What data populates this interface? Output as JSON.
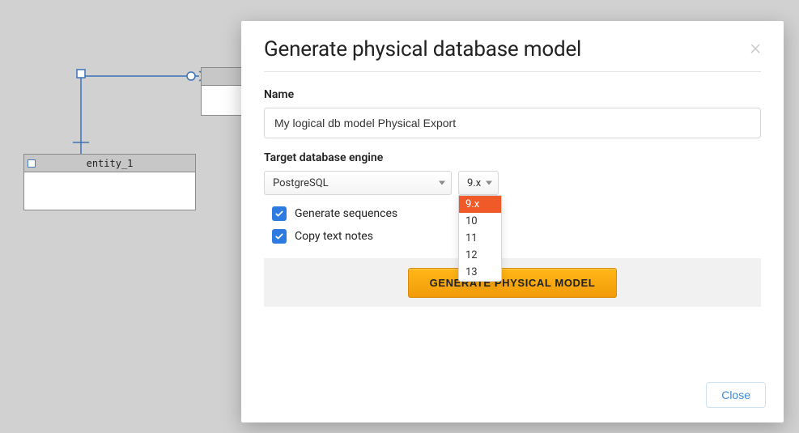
{
  "canvas": {
    "entity1_label": "entity_1"
  },
  "modal": {
    "title": "Generate physical database model",
    "name_label": "Name",
    "name_value": "My logical db model Physical Export",
    "target_label": "Target database engine",
    "engine_value": "PostgreSQL",
    "version_value": "9.x",
    "version_options": [
      "9.x",
      "10",
      "11",
      "12",
      "13"
    ],
    "check_sequences": "Generate sequences",
    "check_notes": "Copy text notes",
    "generate_button": "GENERATE PHYSICAL MODEL",
    "close_button": "Close"
  }
}
